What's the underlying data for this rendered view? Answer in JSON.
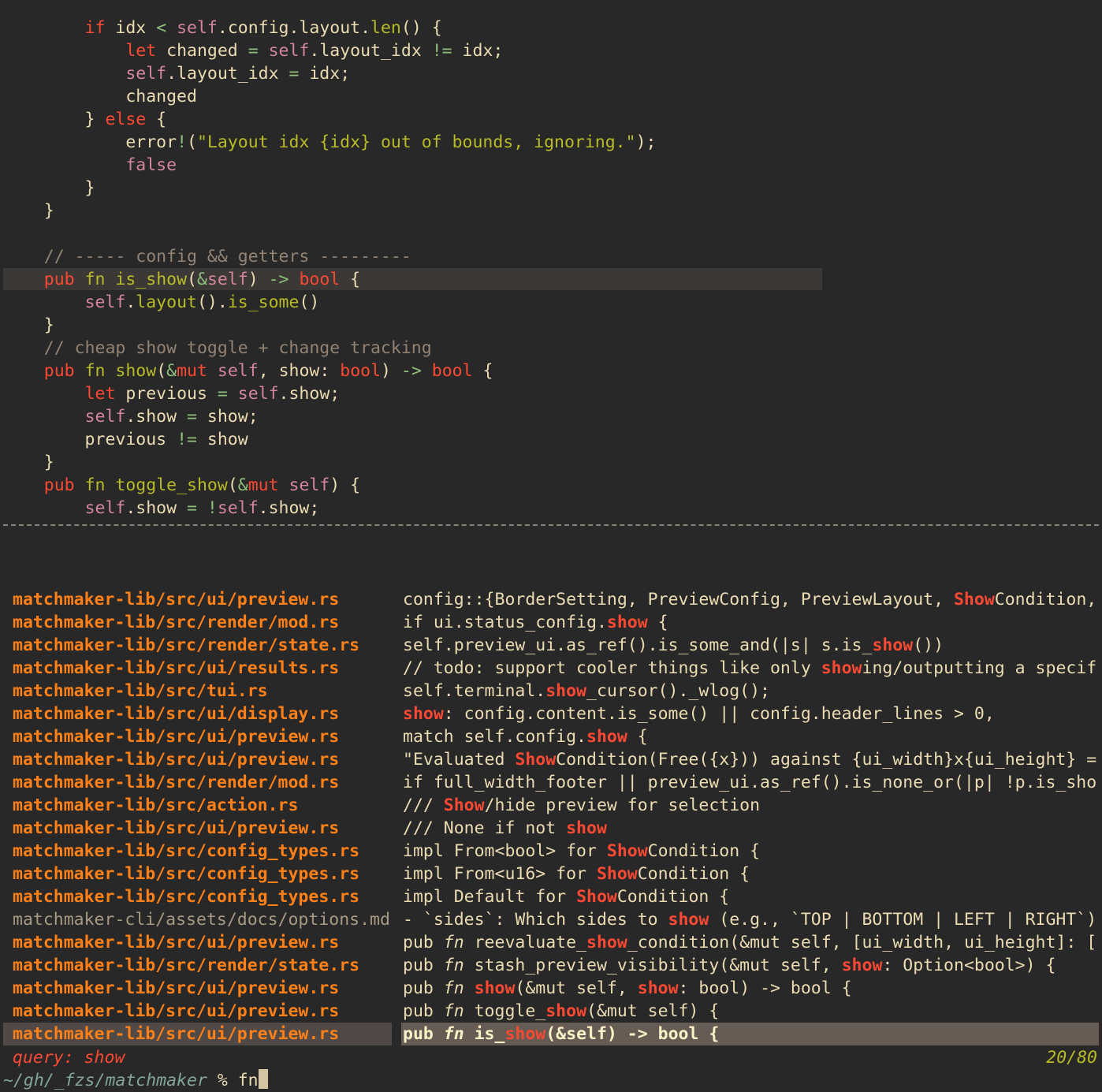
{
  "editor": {
    "code_lines": [
      "        if idx < self.config.layout.len() {",
      "            let changed = self.layout_idx != idx;",
      "            self.layout_idx = idx;",
      "            changed",
      "        } else {",
      "            error!(\"Layout idx {idx} out of bounds, ignoring.\");",
      "            false",
      "        }",
      "    }",
      "",
      "    // ----- config && getters ---------",
      "    pub fn is_show(&self) -> bool {",
      "        self.layout().is_some()",
      "    }",
      "    // cheap show toggle + change tracking",
      "    pub fn show(&mut self, show: bool) -> bool {",
      "        let previous = self.show;",
      "        self.show = show;",
      "        previous != show",
      "    }",
      "    pub fn toggle_show(&mut self) {",
      "        self.show = !self.show;"
    ],
    "highlighted_line_index": 11
  },
  "picker": {
    "results": [
      {
        "file": "matchmaker-lib/src/ui/preview.rs",
        "text": "config::{BorderSetting, PreviewConfig, PreviewLayout, ShowCondition,"
      },
      {
        "file": "matchmaker-lib/src/render/mod.rs",
        "text": "if ui.status_config.show {"
      },
      {
        "file": "matchmaker-lib/src/render/state.rs",
        "text": "self.preview_ui.as_ref().is_some_and(|s| s.is_show())"
      },
      {
        "file": "matchmaker-lib/src/ui/results.rs",
        "text": "// todo: support cooler things like only showing/outputting a specif"
      },
      {
        "file": "matchmaker-lib/src/tui.rs",
        "text": "self.terminal.show_cursor()._wlog();"
      },
      {
        "file": "matchmaker-lib/src/ui/display.rs",
        "text": "show: config.content.is_some() || config.header_lines > 0,"
      },
      {
        "file": "matchmaker-lib/src/ui/preview.rs",
        "text": "match self.config.show {"
      },
      {
        "file": "matchmaker-lib/src/ui/preview.rs",
        "text": "\"Evaluated ShowCondition(Free({x})) against {ui_width}x{ui_height} ="
      },
      {
        "file": "matchmaker-lib/src/render/mod.rs",
        "text": "if full_width_footer || preview_ui.as_ref().is_none_or(|p| !p.is_sho"
      },
      {
        "file": "matchmaker-lib/src/action.rs",
        "text": "/// Show/hide preview for selection"
      },
      {
        "file": "matchmaker-lib/src/ui/preview.rs",
        "text": "/// None if not show"
      },
      {
        "file": "matchmaker-lib/src/config_types.rs",
        "text": "impl From<bool> for ShowCondition {"
      },
      {
        "file": "matchmaker-lib/src/config_types.rs",
        "text": "impl From<u16> for ShowCondition {"
      },
      {
        "file": "matchmaker-lib/src/config_types.rs",
        "text": "impl Default for ShowCondition {"
      },
      {
        "file": "matchmaker-cli/assets/docs/options.md",
        "text": "- `sides`: Which sides to show (e.g., `TOP | BOTTOM | LEFT | RIGHT`)"
      },
      {
        "file": "matchmaker-lib/src/ui/preview.rs",
        "text": "pub fn reevaluate_show_condition(&mut self, [ui_width, ui_height]: ["
      },
      {
        "file": "matchmaker-lib/src/render/state.rs",
        "text": "pub fn stash_preview_visibility(&mut self, show: Option<bool>) {"
      },
      {
        "file": "matchmaker-lib/src/ui/preview.rs",
        "text": "pub fn show(&mut self, show: bool) -> bool {"
      },
      {
        "file": "matchmaker-lib/src/ui/preview.rs",
        "text": "pub fn toggle_show(&mut self) {"
      },
      {
        "file": "matchmaker-lib/src/ui/preview.rs",
        "text": "pub fn is_show(&self) -> bool {"
      }
    ],
    "selected_index": 19,
    "query_label": "query: show",
    "count": "20/80"
  },
  "shell": {
    "cwd": "~/gh/_fzs/matchmaker",
    "prompt_symbol": " % ",
    "input": "fn"
  }
}
